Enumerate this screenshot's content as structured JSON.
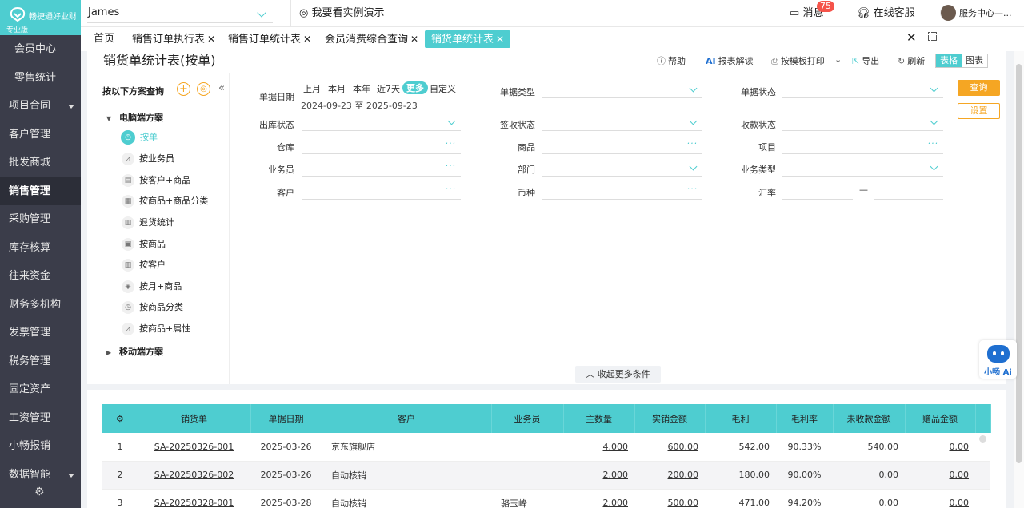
{
  "app": {
    "brand": "畅捷通好业财",
    "edition": "专业版"
  },
  "sidebar": {
    "items": [
      {
        "label": "会员中心",
        "sub": true
      },
      {
        "label": "零售统计",
        "sub": true
      },
      {
        "label": "项目合同",
        "caret": true
      },
      {
        "label": "客户管理"
      },
      {
        "label": "批发商城"
      },
      {
        "label": "销售管理",
        "active": true
      },
      {
        "label": "采购管理"
      },
      {
        "label": "库存核算"
      },
      {
        "label": "往来资金"
      },
      {
        "label": "财务多机构"
      },
      {
        "label": "发票管理"
      },
      {
        "label": "税务管理"
      },
      {
        "label": "固定资产"
      },
      {
        "label": "工资管理"
      },
      {
        "label": "小畅报销"
      },
      {
        "label": "数据智能",
        "caret": true
      }
    ]
  },
  "topbar": {
    "account": "James",
    "demo": "我要看实例演示",
    "messages_label": "消息",
    "messages_count": "75",
    "service_label": "在线客服",
    "center_label": "服务中心—..."
  },
  "tabs": [
    {
      "label": "首页",
      "closable": false
    },
    {
      "label": "销售订单执行表",
      "closable": true
    },
    {
      "label": "销售订单统计表",
      "closable": true
    },
    {
      "label": "会员消费综合查询",
      "closable": true
    },
    {
      "label": "销货单统计表",
      "closable": true,
      "active": true
    }
  ],
  "toolbar": {
    "title": "销货单统计表(按单)",
    "help": "帮助",
    "ai_read": "报表解读",
    "print": "按模板打印",
    "export": "导出",
    "refresh": "刷新",
    "view_table": "表格",
    "view_chart": "图表"
  },
  "tree": {
    "header": "按以下方案查询",
    "groups": [
      {
        "label": "电脑端方案",
        "expanded": true
      },
      {
        "label": "移动端方案",
        "expanded": false
      }
    ],
    "items": [
      {
        "label": "按单",
        "selected": true,
        "icon": "clock-icon"
      },
      {
        "label": "按业务员",
        "icon": "chart-icon"
      },
      {
        "label": "按客户+商品",
        "icon": "card-icon"
      },
      {
        "label": "按商品+商品分类",
        "icon": "grid-icon"
      },
      {
        "label": "退货统计",
        "icon": "bar-icon"
      },
      {
        "label": "按商品",
        "icon": "table-icon"
      },
      {
        "label": "按客户",
        "icon": "bar-icon"
      },
      {
        "label": "按月+商品",
        "icon": "cube-icon"
      },
      {
        "label": "按商品分类",
        "icon": "clock-icon"
      },
      {
        "label": "按商品+属性",
        "icon": "chart-icon"
      }
    ]
  },
  "filters": {
    "date_label": "单据日期",
    "quick": [
      "上月",
      "本月",
      "本年",
      "近7天",
      "更多",
      "自定义"
    ],
    "quick_active": "更多",
    "date_range": "2024-09-23 至 2025-09-23",
    "doc_type": "单据类型",
    "doc_status": "单据状态",
    "out_status": "出库状态",
    "sign_status": "签收状态",
    "pay_status": "收款状态",
    "warehouse": "仓库",
    "product": "商品",
    "project": "项目",
    "salesman": "业务员",
    "dept": "部门",
    "biz_type": "业务类型",
    "customer": "客户",
    "currency": "币种",
    "rate": "汇率",
    "rate_sep": "—",
    "query_btn": "查询",
    "settings_btn": "设置",
    "collapse_more": "收起更多条件"
  },
  "table": {
    "columns": [
      "销货单",
      "单据日期",
      "客户",
      "业务员",
      "主数量",
      "实销金额",
      "毛利",
      "毛利率",
      "未收款金额",
      "赠品金额"
    ],
    "rows": [
      {
        "idx": "1",
        "doc": "SA-20250326-001",
        "date": "2025-03-26",
        "customer": "京东旗舰店",
        "salesman": "",
        "qty": "4.000",
        "amount": "600.00",
        "profit": "542.00",
        "margin": "90.33%",
        "unpaid": "540.00",
        "gift": "0.00"
      },
      {
        "idx": "2",
        "doc": "SA-20250326-002",
        "date": "2025-03-26",
        "customer": "自动核销",
        "salesman": "",
        "qty": "2.000",
        "amount": "200.00",
        "profit": "180.00",
        "margin": "90.00%",
        "unpaid": "0.00",
        "gift": "0.00"
      },
      {
        "idx": "3",
        "doc": "SA-20250328-001",
        "date": "2025-03-28",
        "customer": "自动核销",
        "salesman": "骆玉峰",
        "qty": "2.000",
        "amount": "500.00",
        "profit": "471.00",
        "margin": "94.20%",
        "unpaid": "0.00",
        "gift": "0.00"
      }
    ]
  },
  "ai_widget": {
    "label": "小畅 Ai"
  }
}
